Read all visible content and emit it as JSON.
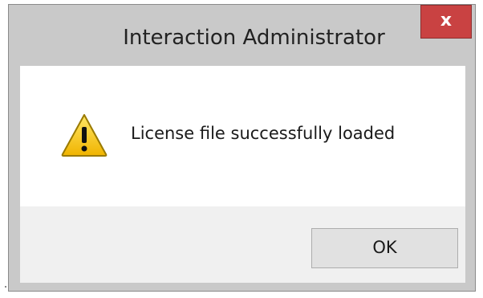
{
  "window": {
    "title": "Interaction Administrator",
    "close_label": "x"
  },
  "message": {
    "icon": "warning-icon",
    "text": "License file successfully loaded"
  },
  "buttons": {
    "ok_label": "OK"
  },
  "colors": {
    "frame": "#c9c9c9",
    "close_button": "#c94242",
    "button_bar": "#f0f0f0",
    "warning_yellow": "#f5c400"
  }
}
